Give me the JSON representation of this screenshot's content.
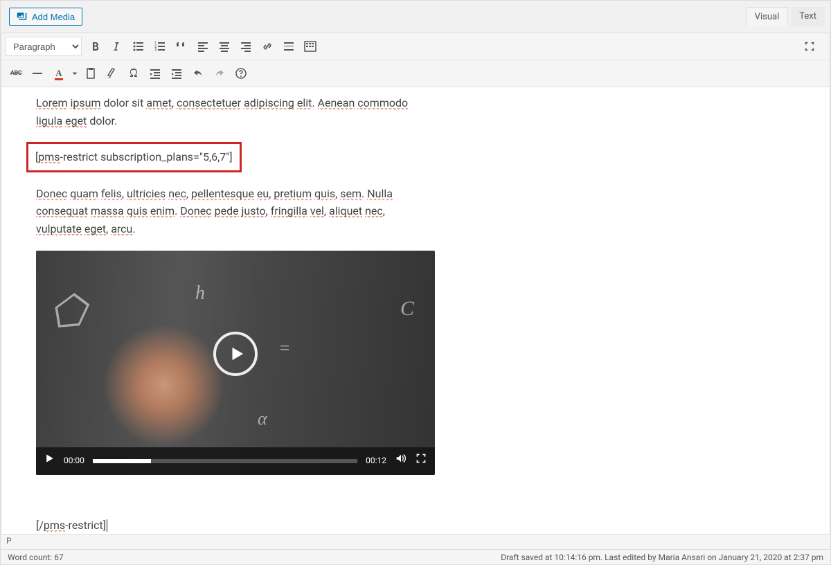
{
  "topbar": {
    "add_media": "Add Media"
  },
  "tabs": {
    "visual": "Visual",
    "text": "Text"
  },
  "toolbar": {
    "format": "Paragraph"
  },
  "content": {
    "para1": "Lorem ipsum dolor sit amet, consectetuer adipiscing elit. Aenean commodo ligula eget dolor.",
    "shortcode_open": "[pms-restrict subscription_plans=\"5,6,7\"]",
    "para2": "Donec quam felis, ultricies nec, pellentesque eu, pretium quis, sem. Nulla consequat massa quis enim. Donec pede justo, fringilla vel, aliquet nec, vulputate eget, arcu.",
    "shortcode_close": "[/pms-restrict]"
  },
  "video": {
    "current_time": "00:00",
    "duration": "00:12"
  },
  "pathbar": {
    "path": "p"
  },
  "status": {
    "word_count_label": "Word count: ",
    "word_count": "67",
    "right": "Draft saved at 10:14:16 pm. Last edited by Maria Ansari on January 21, 2020 at 2:37 pm"
  }
}
